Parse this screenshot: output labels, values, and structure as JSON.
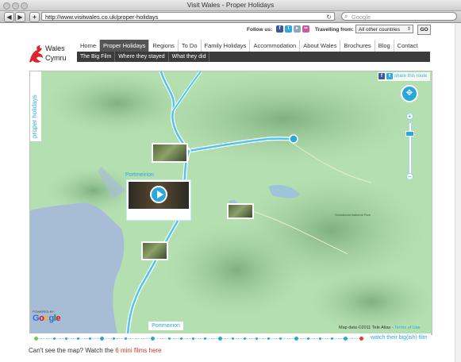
{
  "browser": {
    "window_title": "Visit Wales - Proper Holidays",
    "back_label": "◀",
    "forward_label": "▶",
    "new_tab_label": "+",
    "url": "http://www.visitwales.co.uk/proper-holidays",
    "reload_icon": "↻",
    "search_placeholder": "Google"
  },
  "header": {
    "follow_label": "Follow us:",
    "social_icons": [
      "facebook-icon",
      "twitter-icon",
      "youtube-icon",
      "flickr-icon",
      "rss-icon"
    ],
    "travelling_label": "Travelling from:",
    "country_value": "All other countries",
    "go_label": "GO",
    "logo_line1": "Wales",
    "logo_line2": "Cymru",
    "brand_color": "#d8262e"
  },
  "nav": {
    "items": [
      "Home",
      "Proper Holidays",
      "Regions",
      "To Do",
      "Family Holidays",
      "Accommodation",
      "About Wales",
      "Brochures",
      "Blog",
      "Contact"
    ],
    "active_index": 1
  },
  "subnav": {
    "items": [
      "The Big Film",
      "Where they stayed",
      "What they did"
    ]
  },
  "map": {
    "side_tab": "proper holidays",
    "share_label": "share this route",
    "zoom_in": "+",
    "zoom_out": "−",
    "pan_icon": "✥",
    "label_top": "Portmeirion",
    "label_bottom": "Portmeirion",
    "powered_by": "POWERED BY",
    "google_logo": "Google",
    "attribution_prefix": "Map data ©2011 Tele Atlas - ",
    "terms_label": "Terms of Use",
    "route_color": "#4cc6ee",
    "place_labels": [
      "Snowdonia National Park"
    ]
  },
  "timeline": {
    "watch_label": "watch their big(ish) film",
    "start_color": "#7ac943",
    "end_color": "#e63b2e"
  },
  "footer": {
    "text": "Can't see the map? Watch the ",
    "link": "6 mini films here"
  }
}
